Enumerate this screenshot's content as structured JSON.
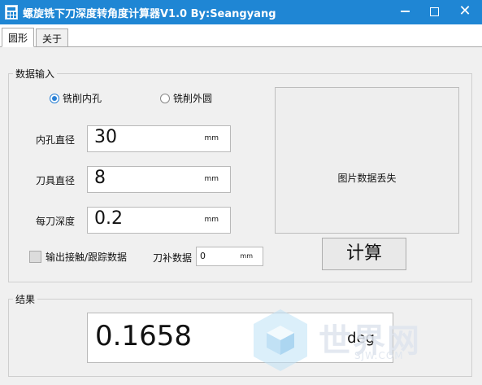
{
  "window": {
    "title": "螺旋铣下刀深度转角度计算器V1.0     By:Seangyang",
    "minimize_glyph": "",
    "close_glyph": "✕"
  },
  "tabs": [
    {
      "label": "圆形",
      "active": true
    },
    {
      "label": "关于",
      "active": false
    }
  ],
  "input_group": {
    "title": "数据输入",
    "radios": [
      {
        "label": "铣削内孔",
        "checked": true
      },
      {
        "label": "铣削外圆",
        "checked": false
      }
    ],
    "fields": [
      {
        "label": "内孔直径",
        "value": "30",
        "unit": "mm"
      },
      {
        "label": "刀具直径",
        "value": "8",
        "unit": "mm"
      },
      {
        "label": "每刀深度",
        "value": "0.2",
        "unit": "mm"
      }
    ],
    "output_checkbox": {
      "label": "输出接触/跟踪数据",
      "checked": false
    },
    "comp": {
      "label": "刀补数据",
      "value": "0",
      "unit": "mm"
    },
    "image_placeholder": "图片数据丢失",
    "calc_button": "计算"
  },
  "result_group": {
    "title": "结果",
    "value": "0.1658",
    "unit": "deg"
  },
  "watermark": {
    "text": "世界网",
    "sub": "SJW.COM"
  },
  "colors": {
    "titlebar": "#1f86d4",
    "accent": "#2a80d5"
  }
}
